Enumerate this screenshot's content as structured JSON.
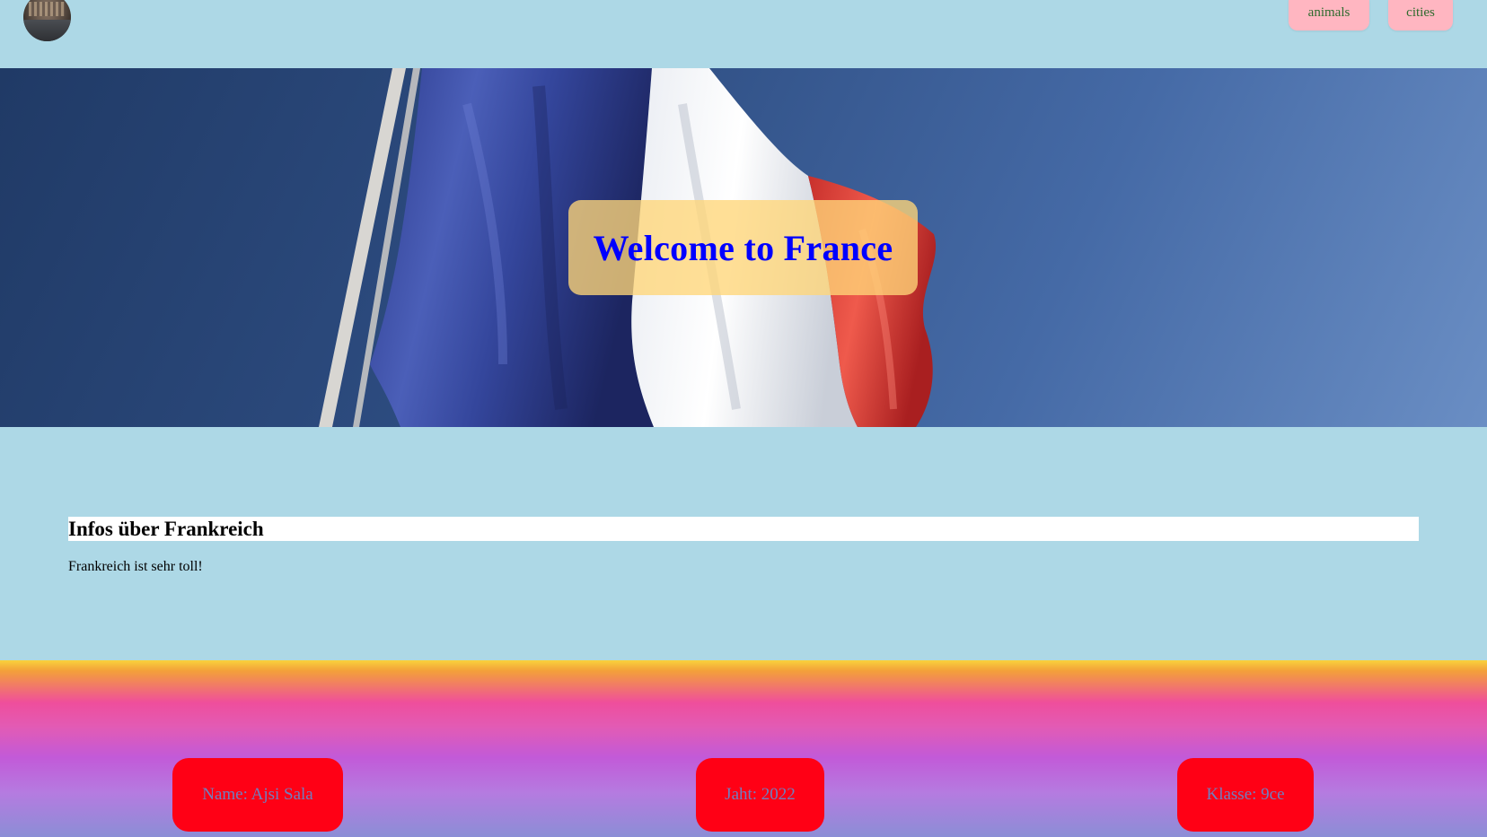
{
  "header": {
    "logo_icon": "city-thumbnail-logo",
    "nav": [
      {
        "label": "animals"
      },
      {
        "label": "cities"
      }
    ],
    "colors": {
      "nav_bg": "#ffb6c1",
      "nav_text": "#2e6b2e",
      "bar_bg": "#add8e6"
    }
  },
  "hero": {
    "title": "Welcome to France",
    "image": "french-flag-waving",
    "colors": {
      "title": "#0000ff",
      "title_box": "#ffd678"
    }
  },
  "main": {
    "heading": "Infos über Frankreich",
    "text": "Frankreich ist sehr toll!"
  },
  "footer": {
    "items": [
      {
        "label": "Name: Ajsi Sala"
      },
      {
        "label": "Jaht: 2022"
      },
      {
        "label": "Klasse: 9ce"
      }
    ],
    "colors": {
      "chip_bg": "#ff0015",
      "chip_text": "#6f7fbf"
    }
  }
}
